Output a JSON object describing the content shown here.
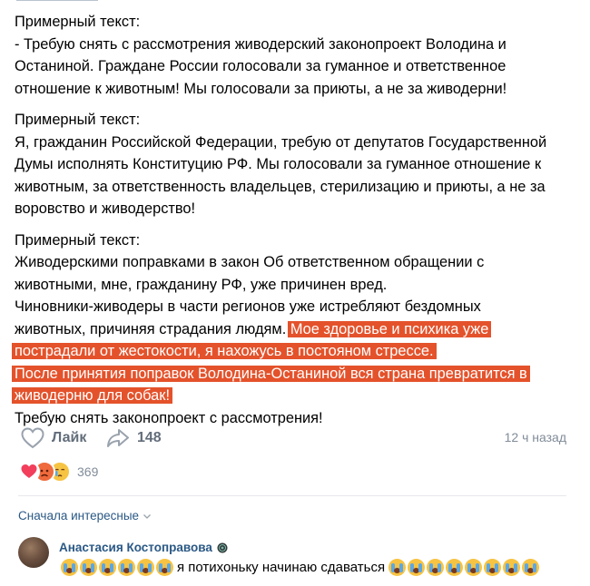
{
  "post": {
    "paragraphs": [
      {
        "lines": [
          {
            "text": "Примерный текст:"
          },
          {
            "text": "- Требую снять с рассмотрения живодерский законопроект Володина и"
          },
          {
            "text": "Останиной. Граждане России голосовали за гуманное и ответственное"
          },
          {
            "text": "отношение к животным! Мы голосовали за приюты, а не за живодерни!"
          }
        ]
      },
      {
        "lines": [
          {
            "text": "Примерный текст:"
          },
          {
            "text": "Я, гражданин Российской Федерации, требую от депутатов Государственной"
          },
          {
            "text": "Думы исполнять Конституцию РФ. Мы голосовали за гуманное отношение к"
          },
          {
            "text": "животным, за ответственность владельцев, стерилизацию и приюты, а не за"
          },
          {
            "text": "воровство и живодерство!"
          }
        ]
      },
      {
        "lines": [
          {
            "text": "Примерный текст:"
          },
          {
            "text": "Живодерскими поправками в закон Об ответственном обращении с"
          },
          {
            "text": "животными, мне, гражданину РФ, уже причинен вред."
          },
          {
            "text": "Чиновники-живодеры в части регионов уже истребляют бездомных"
          },
          {
            "text": "животных, причиняя страдания людям. ",
            "highlight": "Мое здоровье и психика уже"
          },
          {
            "text": "",
            "highlight": "пострадали от жестокости, я нахожусь в постояном стрессе."
          },
          {
            "text": "",
            "highlight": "После принятия поправок Володина-Останиной вся страна превратится в"
          },
          {
            "text": "",
            "highlight": "живодерню для собак!"
          },
          {
            "text": "Требую снять законопроект с рассмотрения!"
          }
        ]
      }
    ],
    "highlight_color": "#e4522b"
  },
  "actions": {
    "like_label": "Лайк",
    "share_count": "148",
    "time": "12 ч назад"
  },
  "reactions": {
    "icons": [
      "heart-reaction",
      "angry-reaction",
      "crying-reaction"
    ],
    "count": "369"
  },
  "comments": {
    "sort_label": "Сначала интересные",
    "items": [
      {
        "author": "Анастасия Костоправова",
        "emoji_before": 6,
        "text": "я потихоньку начинаю сдаваться",
        "emoji_after": 8
      }
    ]
  },
  "colors": {
    "link": "#2a5885",
    "secondary": "#818c99",
    "accent_highlight": "#e4522b"
  }
}
